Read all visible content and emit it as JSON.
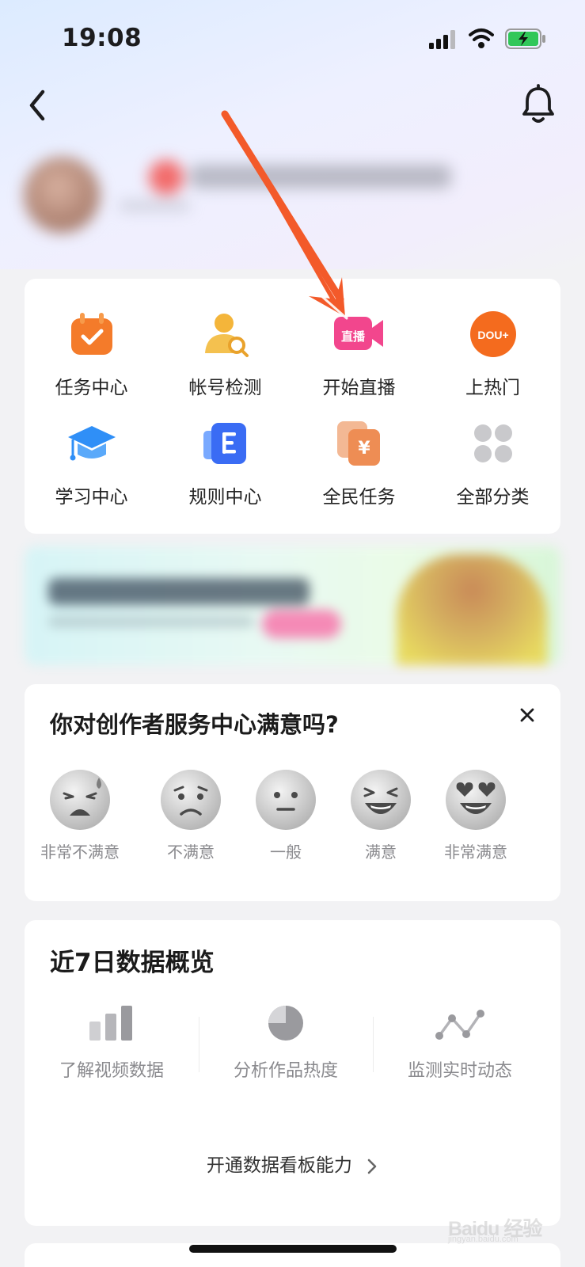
{
  "status_bar": {
    "time": "19:08"
  },
  "tools": [
    {
      "label": "任务中心",
      "icon": "calendar-check-icon"
    },
    {
      "label": "帐号检测",
      "icon": "account-search-icon"
    },
    {
      "label": "开始直播",
      "icon": "live-camera-icon",
      "icon_text": "直播"
    },
    {
      "label": "上热门",
      "icon": "dou-plus-icon",
      "icon_text": "DOU+"
    },
    {
      "label": "学习中心",
      "icon": "graduation-cap-icon"
    },
    {
      "label": "规则中心",
      "icon": "rulebook-icon"
    },
    {
      "label": "全民任务",
      "icon": "yuan-cards-icon",
      "icon_text": "¥"
    },
    {
      "label": "全部分类",
      "icon": "grid-dots-icon"
    }
  ],
  "survey": {
    "title": "你对创作者服务中心满意吗?",
    "options": [
      {
        "label": "非常不满意",
        "icon": "very-unhappy-face-icon"
      },
      {
        "label": "不满意",
        "icon": "unhappy-face-icon"
      },
      {
        "label": "一般",
        "icon": "neutral-face-icon"
      },
      {
        "label": "满意",
        "icon": "happy-face-icon"
      },
      {
        "label": "非常满意",
        "icon": "heart-eyes-face-icon"
      }
    ]
  },
  "data_overview": {
    "title": "近7日数据概览",
    "items": [
      {
        "label": "了解视频数据",
        "icon": "bar-chart-icon"
      },
      {
        "label": "分析作品热度",
        "icon": "pie-chart-icon"
      },
      {
        "label": "监测实时动态",
        "icon": "line-chart-icon"
      }
    ],
    "open_link": "开通数据看板能力"
  },
  "watermark": {
    "brand": "Baidu 经验",
    "url": "jingyan.baidu.com"
  },
  "colors": {
    "annotation_arrow": "#f35a2a",
    "live_pink": "#f2468d",
    "tool_orange": "#f47b2a",
    "accent_blue": "#3a6cf4"
  }
}
